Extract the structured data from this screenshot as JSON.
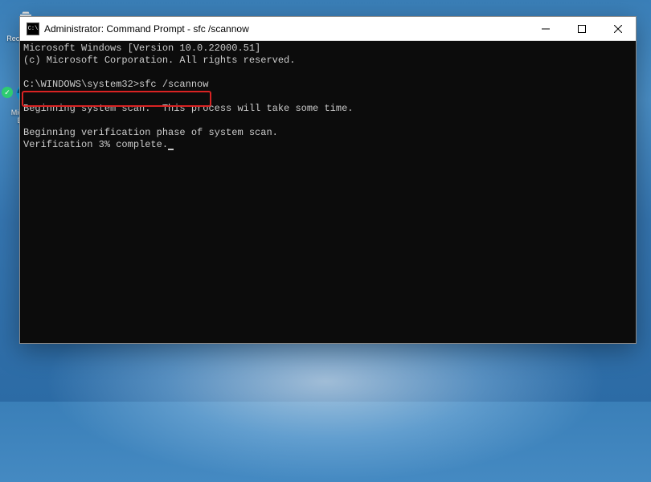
{
  "desktop": {
    "recycle_label": "Recycle Bin",
    "edge_label": "Microsoft Edge"
  },
  "window": {
    "title": "Administrator: Command Prompt - sfc  /scannow",
    "icon_text": "C:\\"
  },
  "terminal": {
    "line1": "Microsoft Windows [Version 10.0.22000.51]",
    "line2": "(c) Microsoft Corporation. All rights reserved.",
    "blank1": "",
    "prompt_line": "C:\\WINDOWS\\system32>sfc /scannow",
    "blank2": "",
    "line_scan": "Beginning system scan.  This process will take some time.",
    "blank3": "",
    "line_verif": "Beginning verification phase of system scan.",
    "line_progress": "Verification 3% complete."
  }
}
